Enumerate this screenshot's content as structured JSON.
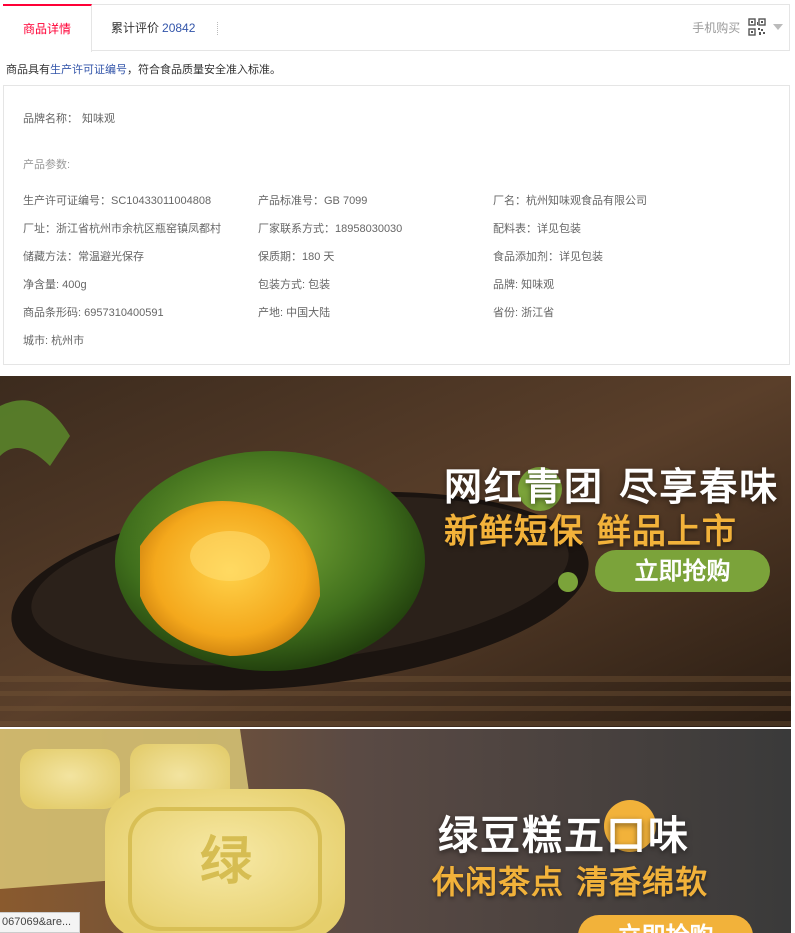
{
  "tabs": {
    "details_label": "商品详情",
    "reviews_label": "累计评价",
    "reviews_count": "20842",
    "mobile_buy_label": "手机购买"
  },
  "notice": {
    "prefix": "商品具有",
    "link": "生产许可证编号",
    "suffix": "，符合食品质量安全准入标准。"
  },
  "attributes": {
    "brand_label": "品牌名称：",
    "brand_value": "知味观",
    "params_title": "产品参数:",
    "rows": [
      [
        "生产许可证编号：SC10433011004808",
        "产品标准号：GB 7099",
        "厂名：杭州知味观食品有限公司"
      ],
      [
        "厂址：浙江省杭州市余杭区瓶窑镇凤都村",
        "厂家联系方式：18958030030",
        "配料表：详见包装"
      ],
      [
        "储藏方法：常温避光保存",
        "保质期：180 天",
        "食品添加剂：详见包装"
      ],
      [
        "净含量: 400g",
        "包装方式: 包装",
        "品牌: 知味观"
      ],
      [
        "商品条形码: 6957310400591",
        "产地: 中国大陆",
        "省份: 浙江省"
      ],
      [
        "城市: 杭州市"
      ]
    ]
  },
  "banner1": {
    "title": "网红青团 尽享春味",
    "subtitle": "新鲜短保 鲜品上市",
    "button": "立即抢购"
  },
  "banner2": {
    "title": "绿豆糕五口味",
    "subtitle": "休闲茶点 清香绵软",
    "button": "立即抢购"
  },
  "status_url": "067069&are...",
  "colors": {
    "accent": "#ff0036",
    "link": "#3355aa",
    "banner_green": "#7ba33a",
    "banner_gold": "#f2b23a"
  }
}
